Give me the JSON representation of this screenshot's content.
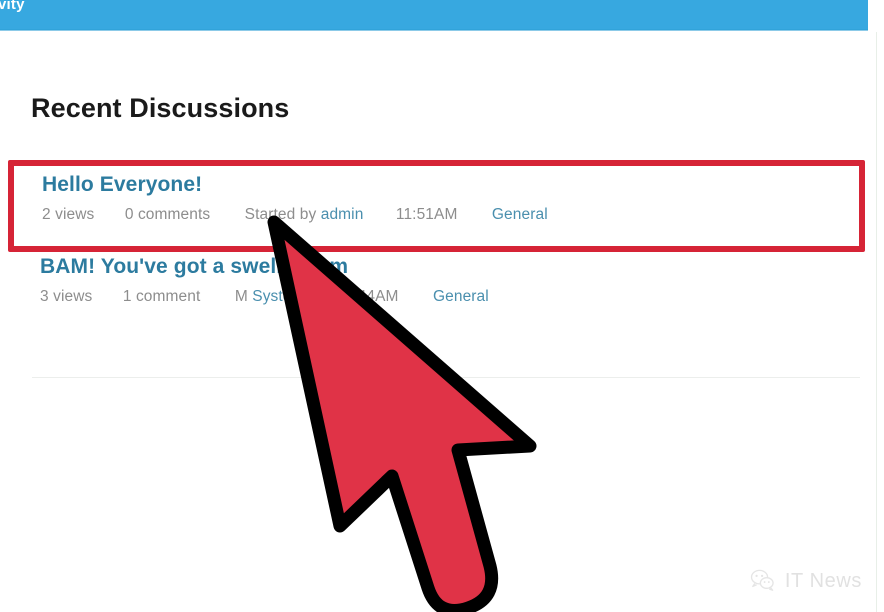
{
  "navbar": {
    "visible_label": "vity",
    "background_color": "#37a8e0"
  },
  "page": {
    "title": "Recent Discussions"
  },
  "discussions": [
    {
      "title": "Hello Everyone!",
      "views": "2 views",
      "comments": "0 comments",
      "byline_prefix": "Started by",
      "author": "admin",
      "time": "11:51AM",
      "category": "General",
      "highlighted": "true"
    },
    {
      "title": "BAM! You've got a swell forum",
      "views": "3 views",
      "comments": "1 comment",
      "byline_prefix": "M",
      "author": "System",
      "time": "11:44AM",
      "category": "General",
      "highlighted": "false"
    }
  ],
  "highlight": {
    "color": "#d62436"
  },
  "cursor": {
    "icon": "mouse-pointer-arrow",
    "fill_color": "#e03347",
    "outline_color": "#000000",
    "tip_x": "272",
    "tip_y": "222"
  },
  "watermark": {
    "icon": "wechat-logo-icon",
    "label": "IT News"
  }
}
